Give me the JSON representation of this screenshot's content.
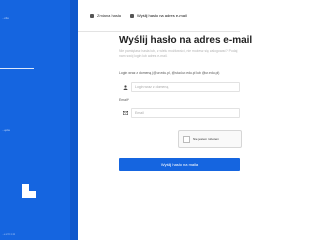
{
  "sidebar": {
    "top_text": "...rdo",
    "mid_text": "...ęcie",
    "bottom_text": "...e 2.0.1.11"
  },
  "tabs": [
    {
      "label": "Zmiana hasła",
      "icon": "key-icon"
    },
    {
      "label": "Wyślij hasło na adres e-mail",
      "icon": "envelope-icon"
    }
  ],
  "form": {
    "title": "Wyślij hasło na adres e-mail",
    "subtitle": "Nie pamiętasz hasła lub, z wielu możliwości, nie możesz się zalogować? Podaj nam swój login lub adres e-mail.",
    "login_label": "Login wraz z domeną (@ur.edu.pl, @stud.ur.edu.pl lub @ur.edu.pl)",
    "login_placeholder": "Login wraz z domeną",
    "email_label": "Email*",
    "email_placeholder": "Email",
    "captcha_label": "Nie jestem robotem",
    "submit_label": "Wyślij hasło na maila"
  },
  "colors": {
    "primary": "#1565e0",
    "text": "#222222",
    "muted": "#b3b3b3"
  }
}
